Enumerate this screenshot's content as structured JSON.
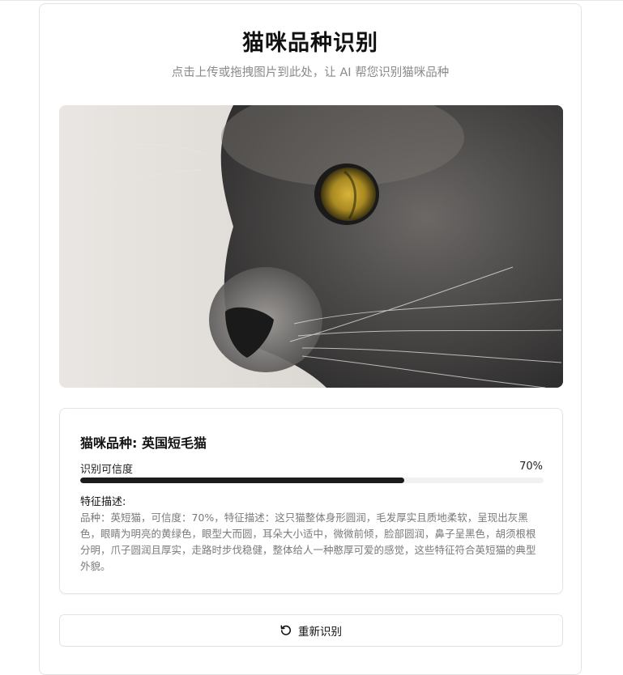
{
  "header": {
    "title": "猫咪品种识别",
    "subtitle": "点击上传或拖拽图片到此处，让 AI 帮您识别猫咪品种"
  },
  "image": {
    "icon": "cat-photo",
    "subject": "grey cat close-up"
  },
  "result": {
    "breed_label": "猫咪品种: 英国短毛猫",
    "confidence_label": "识别可信度",
    "confidence_value": "70%",
    "confidence_fraction": 0.7,
    "features_title": "特征描述:",
    "features_text": "品种：英短猫，可信度：70%，特征描述：这只猫整体身形圆润，毛发厚实且质地柔软，呈现出灰黑色，眼睛为明亮的黄绿色，眼型大而圆，耳朵大小适中，微微前倾，脸部圆润，鼻子呈黑色，胡须根根分明，爪子圆润且厚实，走路时步伐稳健，整体给人一种憨厚可爱的感觉，这些特征符合英短猫的典型外貌。"
  },
  "actions": {
    "retry_label": "重新识别",
    "retry_icon": "refresh-icon"
  },
  "colors": {
    "progress_fill": "#1c1c1c",
    "progress_track": "#f1f1f1",
    "subtitle": "#8a8a8a"
  }
}
